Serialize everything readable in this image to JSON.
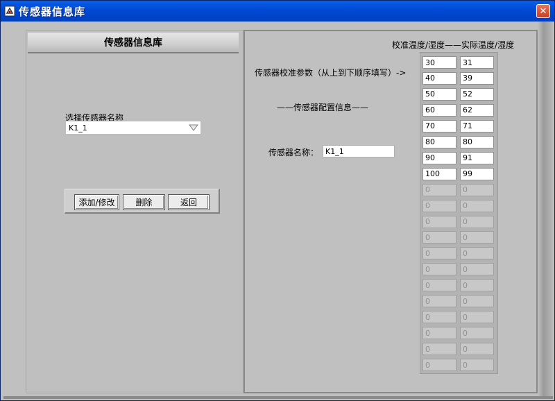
{
  "window": {
    "title": "传感器信息库",
    "close_glyph": "✕"
  },
  "left_panel": {
    "header": "传感器信息库",
    "select_label": "选择传感器名称",
    "select_value": "K1_1",
    "buttons": {
      "add_edit": "添加/修改",
      "delete": "删除",
      "back": "返回"
    }
  },
  "right_panel": {
    "columns_header": "校准温度/湿度——实际温度/湿度",
    "calib_label": "传感器校准参数（从上到下顺序填写）->",
    "config_label": "——传感器配置信息——",
    "name_label": "传感器名称：",
    "name_value": "K1_1",
    "rows": [
      {
        "calib": "30",
        "actual": "31",
        "enabled": true
      },
      {
        "calib": "40",
        "actual": "39",
        "enabled": true
      },
      {
        "calib": "50",
        "actual": "52",
        "enabled": true
      },
      {
        "calib": "60",
        "actual": "62",
        "enabled": true
      },
      {
        "calib": "70",
        "actual": "71",
        "enabled": true
      },
      {
        "calib": "80",
        "actual": "80",
        "enabled": true
      },
      {
        "calib": "90",
        "actual": "91",
        "enabled": true
      },
      {
        "calib": "100",
        "actual": "99",
        "enabled": true
      },
      {
        "calib": "0",
        "actual": "0",
        "enabled": false
      },
      {
        "calib": "0",
        "actual": "0",
        "enabled": false
      },
      {
        "calib": "0",
        "actual": "0",
        "enabled": false
      },
      {
        "calib": "0",
        "actual": "0",
        "enabled": false
      },
      {
        "calib": "0",
        "actual": "0",
        "enabled": false
      },
      {
        "calib": "0",
        "actual": "0",
        "enabled": false
      },
      {
        "calib": "0",
        "actual": "0",
        "enabled": false
      },
      {
        "calib": "0",
        "actual": "0",
        "enabled": false
      },
      {
        "calib": "0",
        "actual": "0",
        "enabled": false
      },
      {
        "calib": "0",
        "actual": "0",
        "enabled": false
      },
      {
        "calib": "0",
        "actual": "0",
        "enabled": false
      },
      {
        "calib": "0",
        "actual": "0",
        "enabled": false
      }
    ]
  }
}
